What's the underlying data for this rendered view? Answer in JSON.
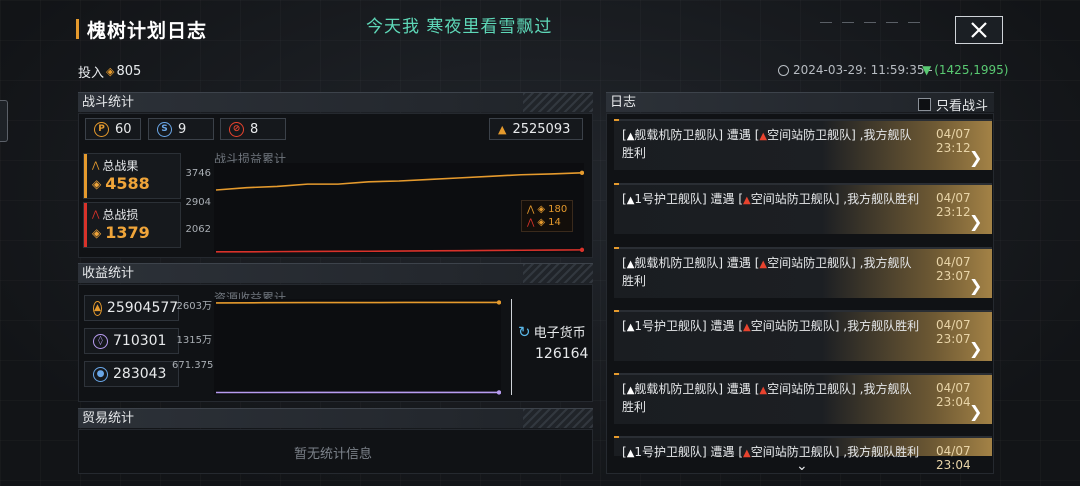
{
  "header": {
    "title": "槐树计划日志",
    "center_text": "今天我 寒夜里看雪飘过",
    "invest_label": "投入",
    "invest_value": "805",
    "timestamp": "2024-03-29: 11:59:35 -",
    "coords": "(1425,1995)"
  },
  "battle_stats": {
    "section_label": "战斗统计",
    "pills": [
      {
        "icon": "orange-p-icon",
        "value": "60"
      },
      {
        "icon": "blue-swirl-icon",
        "value": "9"
      },
      {
        "icon": "red-slash-icon",
        "value": "8"
      }
    ],
    "exp_value": "2525093",
    "total_gain_label": "总战果",
    "total_gain_value": "4588",
    "total_loss_label": "总战损",
    "total_loss_value": "1379",
    "chart_title": "战斗损益累计",
    "legend_gain": "180",
    "legend_loss": "14"
  },
  "income_stats": {
    "section_label": "收益统计",
    "resources": [
      {
        "icon": "triangle-resource-icon",
        "value": "25904577"
      },
      {
        "icon": "purple-crystal-icon",
        "value": "710301"
      },
      {
        "icon": "blue-ore-icon",
        "value": "283043"
      }
    ],
    "chart_title": "资源收益累计",
    "ecurrency_label": "电子货币",
    "ecurrency_value": "126164"
  },
  "trade_stats": {
    "section_label": "贸易统计",
    "empty_text": "暂无统计信息"
  },
  "log": {
    "section_label": "日志",
    "filter_label": "只看战斗",
    "entries": [
      {
        "lb1": "[",
        "unit": "舰载机防卫舰队",
        "rb1": "]",
        "mid": " 遭遇 ",
        "lb2": "[",
        "enemy": "空间站防卫舰队",
        "rb2": "]",
        "tail": " ,我方舰队胜利",
        "time": "04/07 23:12"
      },
      {
        "lb1": "[",
        "unit": "1号护卫舰队",
        "rb1": "]",
        "mid": " 遭遇 ",
        "lb2": "[",
        "enemy": "空间站防卫舰队",
        "rb2": "]",
        "tail": " ,我方舰队胜利",
        "time": "04/07 23:12"
      },
      {
        "lb1": "[",
        "unit": "舰载机防卫舰队",
        "rb1": "]",
        "mid": " 遭遇 ",
        "lb2": "[",
        "enemy": "空间站防卫舰队",
        "rb2": "]",
        "tail": " ,我方舰队胜利",
        "time": "04/07 23:07"
      },
      {
        "lb1": "[",
        "unit": "1号护卫舰队",
        "rb1": "]",
        "mid": " 遭遇 ",
        "lb2": "[",
        "enemy": "空间站防卫舰队",
        "rb2": "]",
        "tail": " ,我方舰队胜利",
        "time": "04/07 23:07"
      },
      {
        "lb1": "[",
        "unit": "舰载机防卫舰队",
        "rb1": "]",
        "mid": " 遭遇 ",
        "lb2": "[",
        "enemy": "空间站防卫舰队",
        "rb2": "]",
        "tail": " ,我方舰队胜利",
        "time": "04/07 23:04"
      },
      {
        "lb1": "[",
        "unit": "1号护卫舰队",
        "rb1": "]",
        "mid": " 遭遇 ",
        "lb2": "[",
        "enemy": "空间站防卫舰队",
        "rb2": "]",
        "tail": " ,我方舰队胜利",
        "time": "04/07 23:04"
      }
    ]
  },
  "chart_data": [
    {
      "type": "line",
      "title": "战斗损益累计",
      "yticks": [
        "3746",
        "2904",
        "2062"
      ],
      "ylim": [
        1800,
        4100
      ],
      "series": [
        {
          "name": "",
          "color": "#e59a2d",
          "values": [
            3410,
            3470,
            3500,
            3560,
            3560,
            3620,
            3640,
            3680,
            3720,
            3760,
            3800,
            3820,
            3850
          ]
        },
        {
          "name": "",
          "color": "#d9322a",
          "values": [
            1830,
            1830,
            1835,
            1840,
            1842,
            1845,
            1850,
            1855,
            1860,
            1865,
            1870,
            1875,
            1880
          ]
        }
      ]
    },
    {
      "type": "line",
      "title": "资源收益累计",
      "yticks": [
        "2603万",
        "1315万",
        "671.375"
      ],
      "ylim": [
        0,
        2700
      ],
      "series": [
        {
          "name": "",
          "color": "#e59a2d",
          "values": [
            2590,
            2595,
            2600,
            2600,
            2602,
            2603,
            2603
          ]
        },
        {
          "name": "",
          "color": "#b79cf0",
          "values": [
            70,
            70,
            71,
            71,
            71,
            71,
            71
          ]
        }
      ]
    }
  ]
}
